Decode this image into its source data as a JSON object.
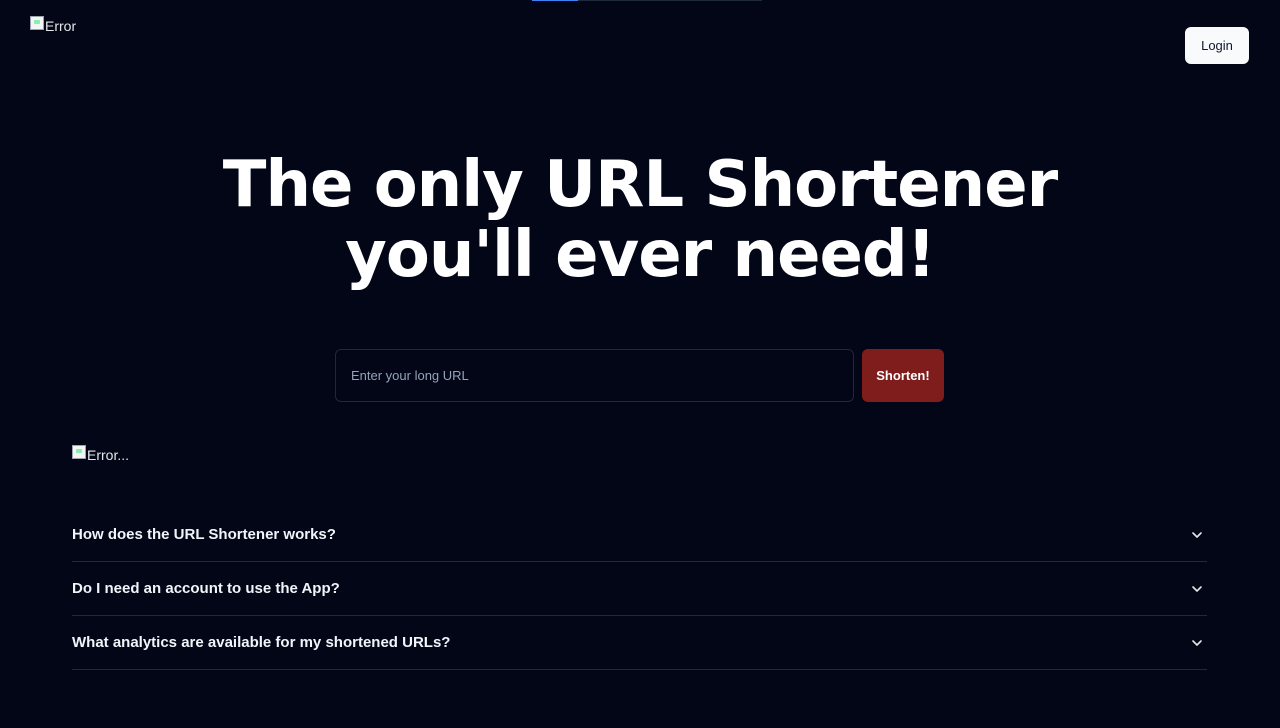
{
  "header": {
    "logo_alt": "Error",
    "login_label": "Login",
    "progress": 0.2
  },
  "hero": {
    "title_line1": "The only URL Shortener",
    "title_line2": "you'll ever need!"
  },
  "shorten_form": {
    "placeholder": "Enter your long URL",
    "value": "",
    "button_label": "Shorten!",
    "button_color": "#7f1d1d"
  },
  "illustration": {
    "alt": "Error..."
  },
  "faq": {
    "items": [
      {
        "question": "How does the URL Shortener works?",
        "icon": "chevron-down-icon"
      },
      {
        "question": "Do I need an account to use the App?",
        "icon": "chevron-down-icon"
      },
      {
        "question": "What analytics are available for my shortened URLs?",
        "icon": "chevron-down-icon"
      }
    ]
  },
  "colors": {
    "background": "#020617",
    "border": "#1e293b",
    "accent": "#3b82f6"
  }
}
